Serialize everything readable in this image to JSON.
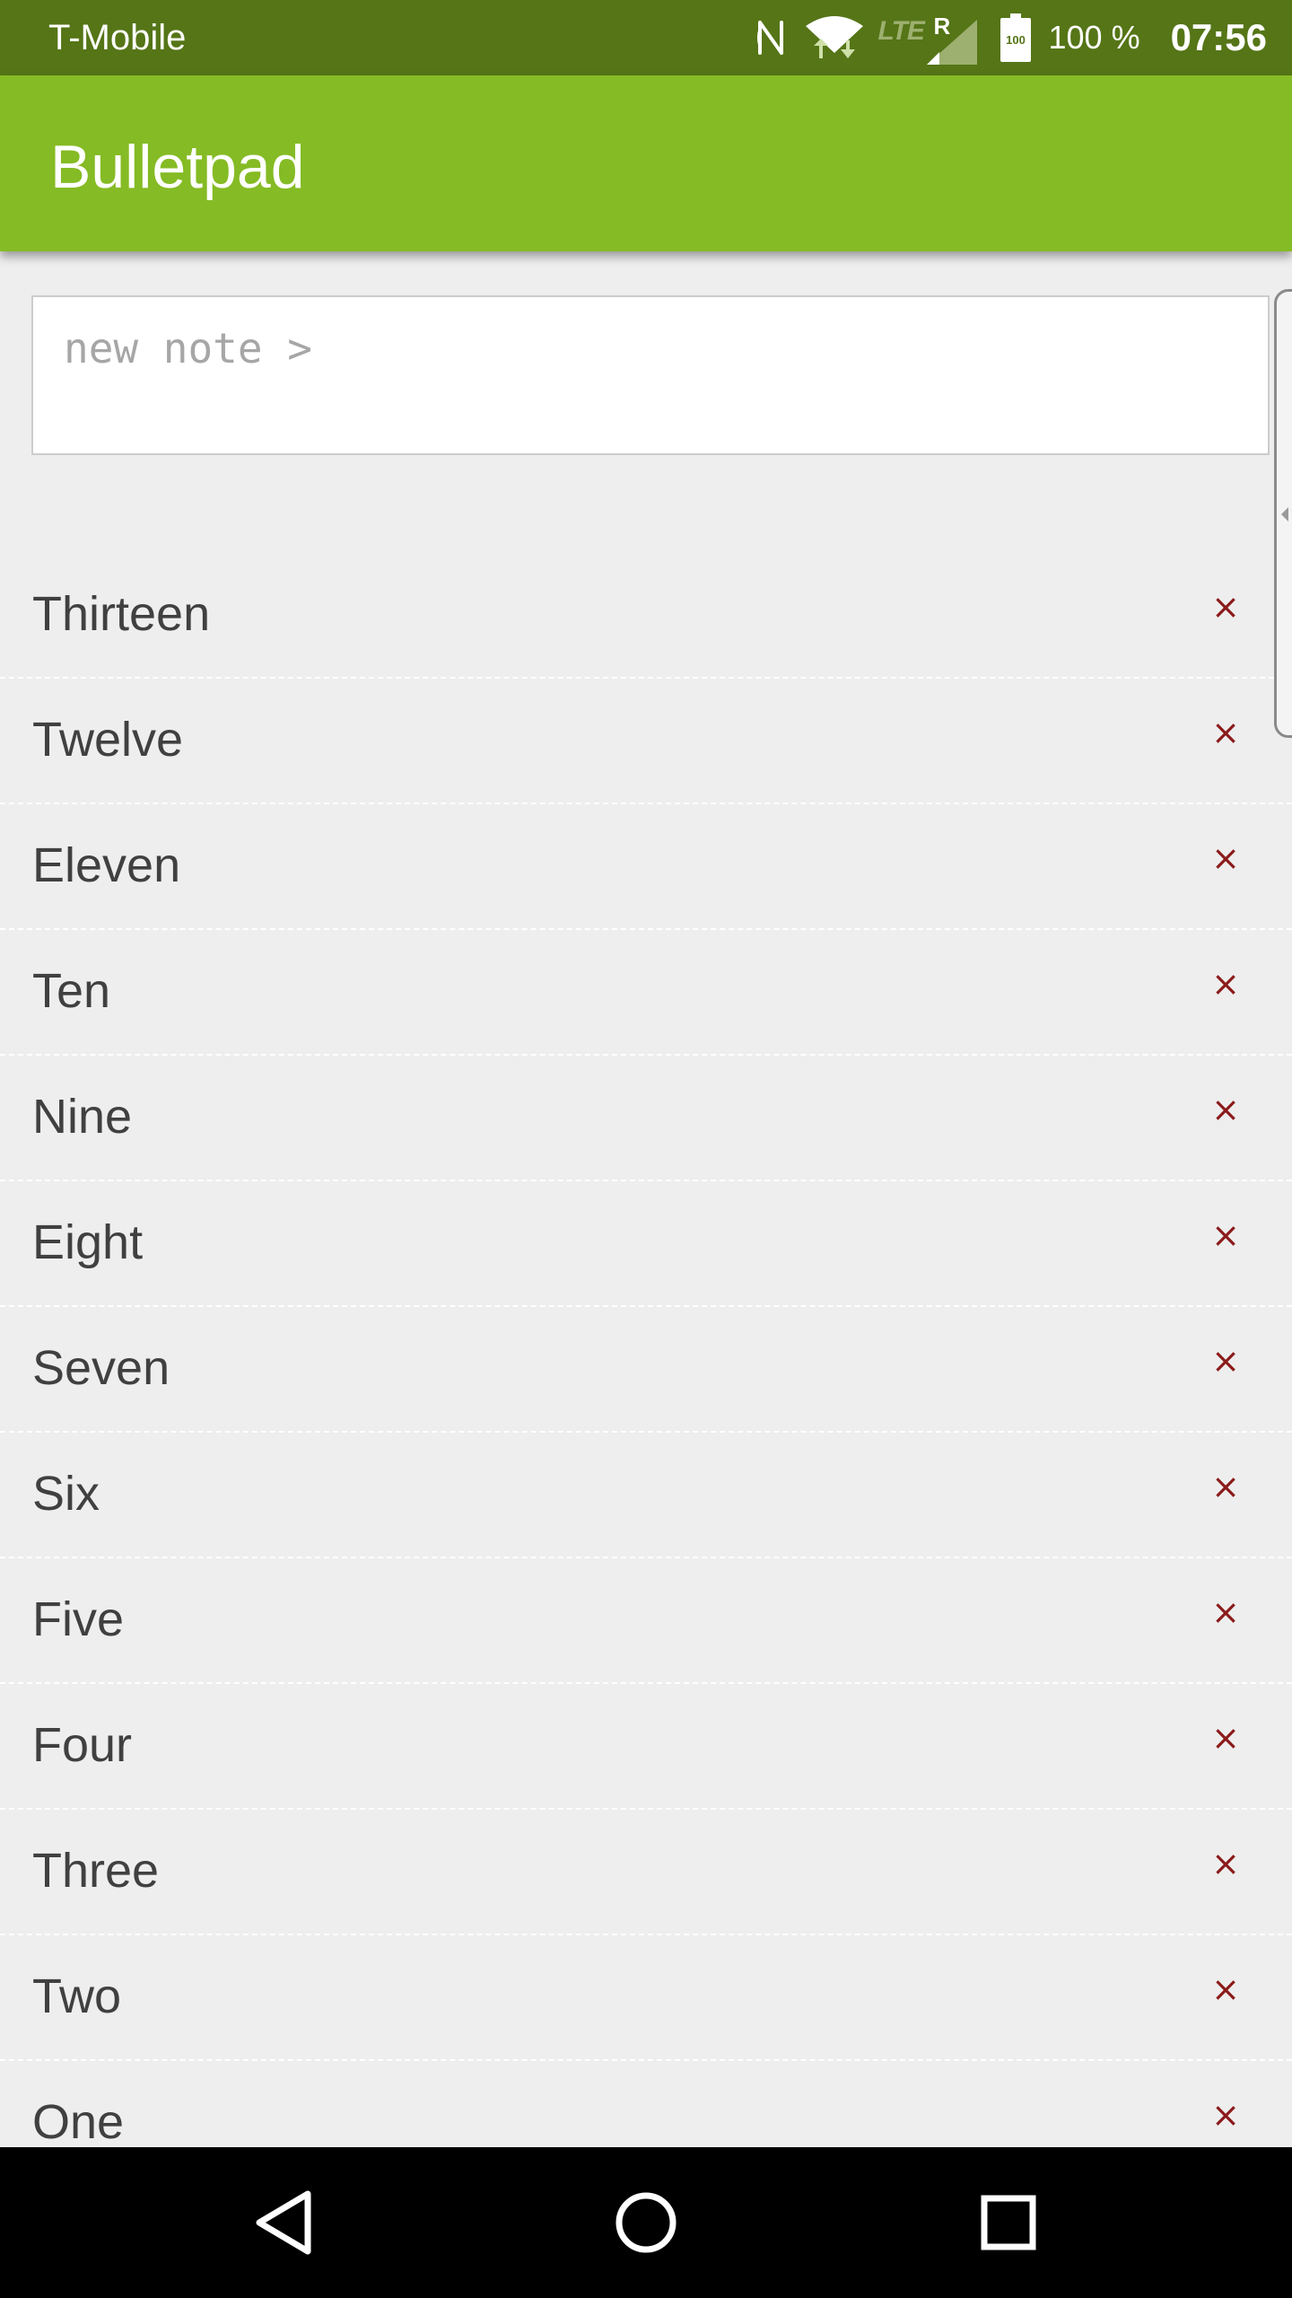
{
  "status_bar": {
    "carrier": "T-Mobile",
    "network_type": "LTE",
    "roaming_indicator": "R",
    "battery_level": "100",
    "battery_percent": "100 %",
    "time": "07:56",
    "icons": [
      "nfc-icon",
      "wifi-icon",
      "signal-icon",
      "battery-icon"
    ]
  },
  "app_bar": {
    "title": "Bulletpad"
  },
  "new_note": {
    "placeholder": "new note >",
    "value": ""
  },
  "notes": [
    {
      "text": "Thirteen",
      "delete": "×"
    },
    {
      "text": "Twelve",
      "delete": "×"
    },
    {
      "text": "Eleven",
      "delete": "×"
    },
    {
      "text": "Ten",
      "delete": "×"
    },
    {
      "text": "Nine",
      "delete": "×"
    },
    {
      "text": "Eight",
      "delete": "×"
    },
    {
      "text": "Seven",
      "delete": "×"
    },
    {
      "text": "Six",
      "delete": "×"
    },
    {
      "text": "Five",
      "delete": "×"
    },
    {
      "text": "Four",
      "delete": "×"
    },
    {
      "text": "Three",
      "delete": "×"
    },
    {
      "text": "Two",
      "delete": "×"
    },
    {
      "text": "One",
      "delete": "×"
    }
  ],
  "nav_bar": {
    "icons": [
      "back-icon",
      "home-icon",
      "recent-apps-icon"
    ]
  },
  "colors": {
    "status_bar": "#557517",
    "app_bar": "#85bb24",
    "background": "#eeeeee",
    "delete": "#8b1a1a",
    "note_text": "#404040"
  }
}
